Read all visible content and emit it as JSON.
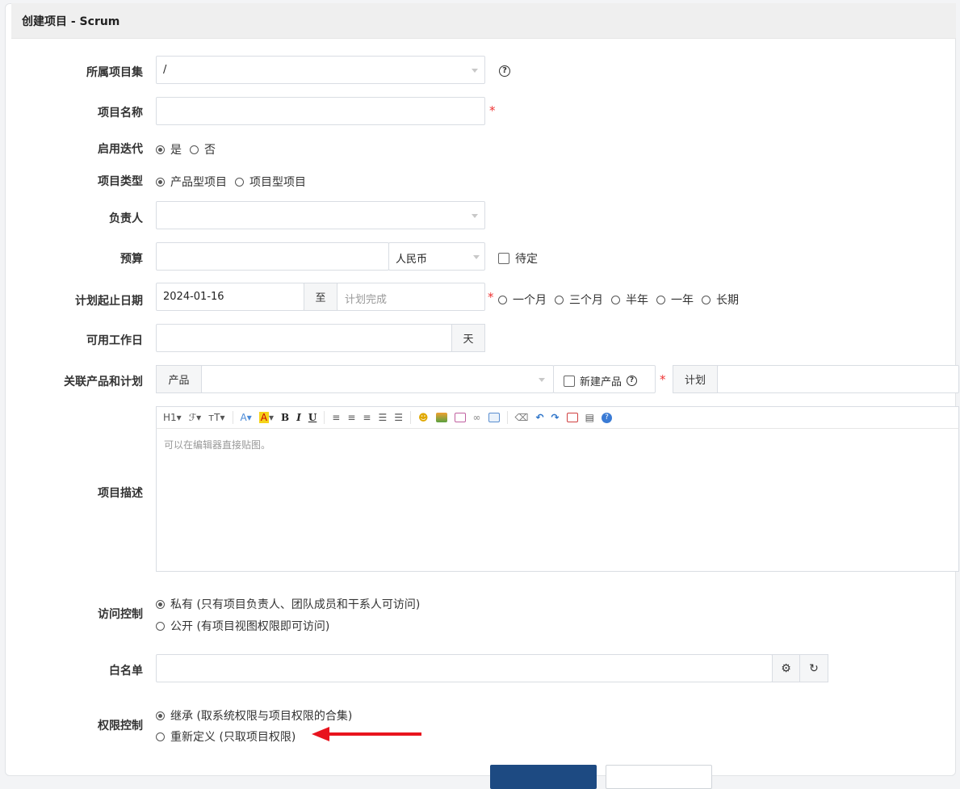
{
  "panel": {
    "title": "创建项目 - Scrum"
  },
  "form": {
    "program": {
      "label": "所属项目集",
      "value": "/"
    },
    "name": {
      "label": "项目名称",
      "value": "",
      "required": "*"
    },
    "iteration": {
      "label": "启用迭代",
      "options": [
        "是",
        "否"
      ],
      "selected": "是"
    },
    "type": {
      "label": "项目类型",
      "options": [
        "产品型项目",
        "项目型项目"
      ],
      "selected": "产品型项目"
    },
    "owner": {
      "label": "负责人",
      "value": ""
    },
    "budget": {
      "label": "预算",
      "value": "",
      "currency": "人民币",
      "tbd_label": "待定"
    },
    "dates": {
      "label": "计划起止日期",
      "begin": "2024-01-16",
      "separator": "至",
      "end_placeholder": "计划完成",
      "required": "*",
      "quick_options": [
        "一个月",
        "三个月",
        "半年",
        "一年",
        "长期"
      ]
    },
    "workdays": {
      "label": "可用工作日",
      "value": "",
      "unit": "天"
    },
    "products": {
      "label": "关联产品和计划",
      "product_addon": "产品",
      "new_product_label": "新建产品",
      "required": "*",
      "plan_addon": "计划"
    },
    "desc": {
      "label": "项目描述",
      "placeholder": "可以在编辑器直接贴图。",
      "toolbar": {
        "heading": "H1",
        "font": "ℱ",
        "size": "тT",
        "font_color": "A",
        "bg_color": "A",
        "bold": "B",
        "italic": "I",
        "underline": "U"
      }
    },
    "acl": {
      "label": "访问控制",
      "options": [
        "私有 (只有项目负责人、团队成员和干系人可访问)",
        "公开 (有项目视图权限即可访问)"
      ],
      "selected": 0
    },
    "whitelist": {
      "label": "白名单",
      "value": ""
    },
    "auth": {
      "label": "权限控制",
      "options": [
        "继承 (取系统权限与项目权限的合集)",
        "重新定义 (只取项目权限)"
      ],
      "selected": 0
    }
  },
  "colors": {
    "primary": "#1d4a82",
    "required": "#ee3333",
    "annotation_arrow": "#e8141e"
  }
}
